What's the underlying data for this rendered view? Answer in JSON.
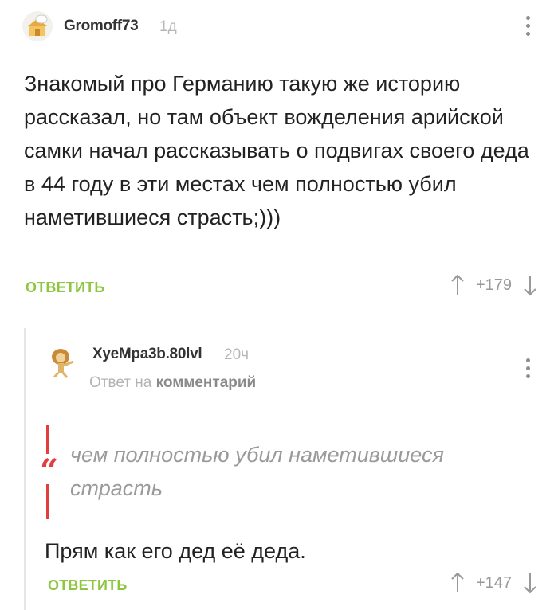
{
  "comments": [
    {
      "author": "Gromoff73",
      "time": "1д",
      "text": "Знакомый про Германию такую же историю рассказал, но там объект вожделения арийской самки начал рассказывать о подвигах своего деда в 44 году в эти местах чем полностью убил наметившиеся страсть;)))",
      "reply_label": "ОТВЕТИТЬ",
      "rating": "+179",
      "icons": {
        "menu": "more-vertical-icon",
        "upvote": "arrow-up-icon",
        "downvote": "arrow-down-icon"
      }
    },
    {
      "author": "XyeMpa3b.80lvl",
      "time": "20ч",
      "reply_prefix": "Ответ на",
      "reply_target": "комментарий",
      "quote": "чем полностью убил наметившиеся страсть",
      "text": "Прям как его дед её деда.",
      "reply_label": "ОТВЕТИТЬ",
      "rating": "+147",
      "icons": {
        "menu": "more-vertical-icon",
        "upvote": "arrow-up-icon",
        "downvote": "arrow-down-icon",
        "quote": "quote-icon"
      }
    }
  ],
  "colors": {
    "accent": "#8dc63f",
    "quote": "#e33d3d",
    "muted": "#999999"
  }
}
